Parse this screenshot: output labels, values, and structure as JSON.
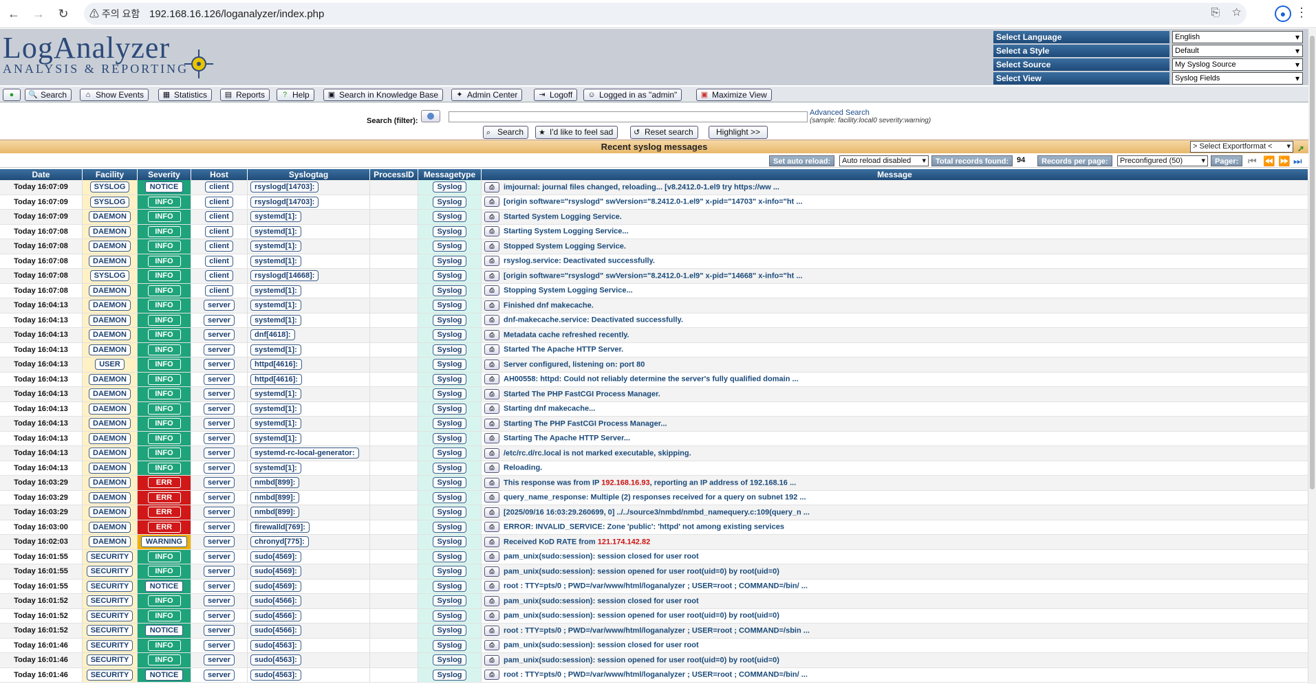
{
  "browser": {
    "warning": "주의 요함",
    "url": "192.168.16.126/loganalyzer/index.php"
  },
  "logo": {
    "title": "LogAnalyzer",
    "subtitle": "ANALYSIS & REPORTING"
  },
  "selects": [
    {
      "label": "Select Language",
      "value": "English"
    },
    {
      "label": "Select a Style",
      "value": "Default"
    },
    {
      "label": "Select Source",
      "value": "My Syslog Source"
    },
    {
      "label": "Select View",
      "value": "Syslog Fields"
    }
  ],
  "toolbar": {
    "search": "Search",
    "show_events": "Show Events",
    "statistics": "Statistics",
    "reports": "Reports",
    "help": "Help",
    "kb": "Search in Knowledge Base",
    "admin": "Admin Center",
    "logoff": "Logoff",
    "logged": "Logged in as \"admin\"",
    "maximize": "Maximize View"
  },
  "search": {
    "label": "Search (filter):",
    "advanced": "Advanced Search",
    "sample": "(sample: facility:local0 severity:warning)",
    "btn_search": "Search",
    "btn_sad": "I'd like to feel sad",
    "btn_reset": "Reset search",
    "btn_highlight": "Highlight >>"
  },
  "title": "Recent syslog messages",
  "export": "> Select Exportformat <",
  "pager": {
    "auto_reload_label": "Set auto reload:",
    "auto_reload_value": "Auto reload disabled",
    "total_label": "Total records found:",
    "total_value": "94",
    "per_page_label": "Records per page:",
    "per_page_value": "Preconfigured (50)",
    "pager_label": "Pager:"
  },
  "columns": [
    "Date",
    "Facility",
    "Severity",
    "Host",
    "Syslogtag",
    "ProcessID",
    "Messagetype",
    "Message"
  ],
  "rows": [
    [
      "Today 16:07:09",
      "SYSLOG",
      "NOTICE",
      "client",
      "rsyslogd[14703]:",
      "",
      "Syslog",
      "imjournal: journal files changed, reloading... [v8.2412.0-1.el9 try https://ww ..."
    ],
    [
      "Today 16:07:09",
      "SYSLOG",
      "INFO",
      "client",
      "rsyslogd[14703]:",
      "",
      "Syslog",
      "[origin software=\"rsyslogd\" swVersion=\"8.2412.0-1.el9\" x-pid=\"14703\" x-info=\"ht ..."
    ],
    [
      "Today 16:07:09",
      "DAEMON",
      "INFO",
      "client",
      "systemd[1]:",
      "",
      "Syslog",
      "Started System Logging Service."
    ],
    [
      "Today 16:07:08",
      "DAEMON",
      "INFO",
      "client",
      "systemd[1]:",
      "",
      "Syslog",
      "Starting System Logging Service..."
    ],
    [
      "Today 16:07:08",
      "DAEMON",
      "INFO",
      "client",
      "systemd[1]:",
      "",
      "Syslog",
      "Stopped System Logging Service."
    ],
    [
      "Today 16:07:08",
      "DAEMON",
      "INFO",
      "client",
      "systemd[1]:",
      "",
      "Syslog",
      "rsyslog.service: Deactivated successfully."
    ],
    [
      "Today 16:07:08",
      "SYSLOG",
      "INFO",
      "client",
      "rsyslogd[14668]:",
      "",
      "Syslog",
      "[origin software=\"rsyslogd\" swVersion=\"8.2412.0-1.el9\" x-pid=\"14668\" x-info=\"ht ..."
    ],
    [
      "Today 16:07:08",
      "DAEMON",
      "INFO",
      "client",
      "systemd[1]:",
      "",
      "Syslog",
      "Stopping System Logging Service..."
    ],
    [
      "Today 16:04:13",
      "DAEMON",
      "INFO",
      "server",
      "systemd[1]:",
      "",
      "Syslog",
      "Finished dnf makecache."
    ],
    [
      "Today 16:04:13",
      "DAEMON",
      "INFO",
      "server",
      "systemd[1]:",
      "",
      "Syslog",
      "dnf-makecache.service: Deactivated successfully."
    ],
    [
      "Today 16:04:13",
      "DAEMON",
      "INFO",
      "server",
      "dnf[4618]:",
      "",
      "Syslog",
      "Metadata cache refreshed recently."
    ],
    [
      "Today 16:04:13",
      "DAEMON",
      "INFO",
      "server",
      "systemd[1]:",
      "",
      "Syslog",
      "Started The Apache HTTP Server."
    ],
    [
      "Today 16:04:13",
      "USER",
      "INFO",
      "server",
      "httpd[4616]:",
      "",
      "Syslog",
      "Server configured, listening on: port 80"
    ],
    [
      "Today 16:04:13",
      "DAEMON",
      "INFO",
      "server",
      "httpd[4616]:",
      "",
      "Syslog",
      "AH00558: httpd: Could not reliably determine the server's fully qualified domain ..."
    ],
    [
      "Today 16:04:13",
      "DAEMON",
      "INFO",
      "server",
      "systemd[1]:",
      "",
      "Syslog",
      "Started The PHP FastCGI Process Manager."
    ],
    [
      "Today 16:04:13",
      "DAEMON",
      "INFO",
      "server",
      "systemd[1]:",
      "",
      "Syslog",
      "Starting dnf makecache..."
    ],
    [
      "Today 16:04:13",
      "DAEMON",
      "INFO",
      "server",
      "systemd[1]:",
      "",
      "Syslog",
      "Starting The PHP FastCGI Process Manager..."
    ],
    [
      "Today 16:04:13",
      "DAEMON",
      "INFO",
      "server",
      "systemd[1]:",
      "",
      "Syslog",
      "Starting The Apache HTTP Server..."
    ],
    [
      "Today 16:04:13",
      "DAEMON",
      "INFO",
      "server",
      "systemd-rc-local-generator:",
      "",
      "Syslog",
      "/etc/rc.d/rc.local is not marked executable, skipping."
    ],
    [
      "Today 16:04:13",
      "DAEMON",
      "INFO",
      "server",
      "systemd[1]:",
      "",
      "Syslog",
      "Reloading."
    ],
    [
      "Today 16:03:29",
      "DAEMON",
      "ERR",
      "server",
      "nmbd[899]:",
      "",
      "Syslog",
      "This response was from IP |192.168.16.93|, reporting an IP address of 192.168.16 ..."
    ],
    [
      "Today 16:03:29",
      "DAEMON",
      "ERR",
      "server",
      "nmbd[899]:",
      "",
      "Syslog",
      "query_name_response: Multiple (2) responses received for a query on subnet 192 ..."
    ],
    [
      "Today 16:03:29",
      "DAEMON",
      "ERR",
      "server",
      "nmbd[899]:",
      "",
      "Syslog",
      "[2025/09/16 16:03:29.260699, 0] ../../source3/nmbd/nmbd_namequery.c:109(query_n ..."
    ],
    [
      "Today 16:03:00",
      "DAEMON",
      "ERR",
      "server",
      "firewalld[769]:",
      "",
      "Syslog",
      "ERROR: INVALID_SERVICE: Zone 'public': 'httpd' not among existing services"
    ],
    [
      "Today 16:02:03",
      "DAEMON",
      "WARNING",
      "server",
      "chronyd[775]:",
      "",
      "Syslog",
      "Received KoD RATE from |121.174.142.82|"
    ],
    [
      "Today 16:01:55",
      "SECURITY",
      "INFO",
      "server",
      "sudo[4569]:",
      "",
      "Syslog",
      "pam_unix(sudo:session): session closed for user root"
    ],
    [
      "Today 16:01:55",
      "SECURITY",
      "INFO",
      "server",
      "sudo[4569]:",
      "",
      "Syslog",
      "pam_unix(sudo:session): session opened for user root(uid=0) by root(uid=0)"
    ],
    [
      "Today 16:01:55",
      "SECURITY",
      "NOTICE",
      "server",
      "sudo[4569]:",
      "",
      "Syslog",
      "root : TTY=pts/0 ; PWD=/var/www/html/loganalyzer ; USER=root ; COMMAND=/bin/ ..."
    ],
    [
      "Today 16:01:52",
      "SECURITY",
      "INFO",
      "server",
      "sudo[4566]:",
      "",
      "Syslog",
      "pam_unix(sudo:session): session closed for user root"
    ],
    [
      "Today 16:01:52",
      "SECURITY",
      "INFO",
      "server",
      "sudo[4566]:",
      "",
      "Syslog",
      "pam_unix(sudo:session): session opened for user root(uid=0) by root(uid=0)"
    ],
    [
      "Today 16:01:52",
      "SECURITY",
      "NOTICE",
      "server",
      "sudo[4566]:",
      "",
      "Syslog",
      "root : TTY=pts/0 ; PWD=/var/www/html/loganalyzer ; USER=root ; COMMAND=/sbin ..."
    ],
    [
      "Today 16:01:46",
      "SECURITY",
      "INFO",
      "server",
      "sudo[4563]:",
      "",
      "Syslog",
      "pam_unix(sudo:session): session closed for user root"
    ],
    [
      "Today 16:01:46",
      "SECURITY",
      "INFO",
      "server",
      "sudo[4563]:",
      "",
      "Syslog",
      "pam_unix(sudo:session): session opened for user root(uid=0) by root(uid=0)"
    ],
    [
      "Today 16:01:46",
      "SECURITY",
      "NOTICE",
      "server",
      "sudo[4563]:",
      "",
      "Syslog",
      "root : TTY=pts/0 ; PWD=/var/www/html/loganalyzer ; USER=root ; COMMAND=/bin/ ..."
    ]
  ]
}
